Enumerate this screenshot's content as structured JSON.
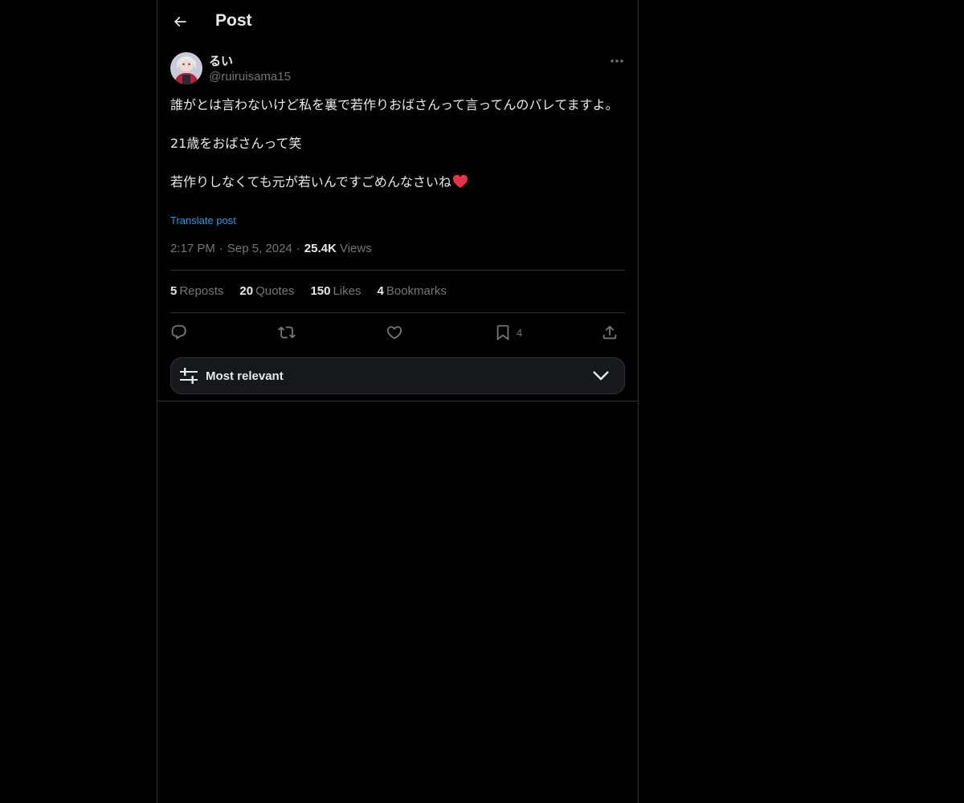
{
  "header": {
    "title": "Post",
    "back_icon": "arrow-left-icon"
  },
  "author": {
    "display_name": "るい",
    "handle": "@ruiruisama15",
    "avatar": "user-avatar",
    "more_icon": "more-horizontal-icon"
  },
  "post": {
    "lines": [
      "誰がとは言わないけど私を裏で若作りおばさんって言ってんのバレてますよ。",
      "21歳をおばさんって笑",
      "若作りしなくても元が若いんですごめんなさいね"
    ],
    "emoji": "red-heart-emoji",
    "translate_label": "Translate post"
  },
  "meta": {
    "time": "2:17 PM",
    "date": "Sep 5, 2024",
    "views_count": "25.4K",
    "views_label": "Views",
    "separator": "·"
  },
  "stats": [
    {
      "count": "5",
      "label": "Reposts"
    },
    {
      "count": "20",
      "label": "Quotes"
    },
    {
      "count": "150",
      "label": "Likes"
    },
    {
      "count": "4",
      "label": "Bookmarks"
    }
  ],
  "actions": {
    "reply_icon": "reply-icon",
    "repost_icon": "repost-icon",
    "like_icon": "heart-icon",
    "bookmark_icon": "bookmark-icon",
    "bookmark_count": "4",
    "share_icon": "share-icon"
  },
  "sort": {
    "label": "Most relevant",
    "icon": "sliders-icon",
    "chevron": "chevron-down-icon"
  },
  "colors": {
    "background": "#000000",
    "text": "#e7e9ea",
    "muted": "#71767b",
    "border": "#2f3336",
    "accent": "#1d9bf0",
    "heart": "#f91880"
  }
}
